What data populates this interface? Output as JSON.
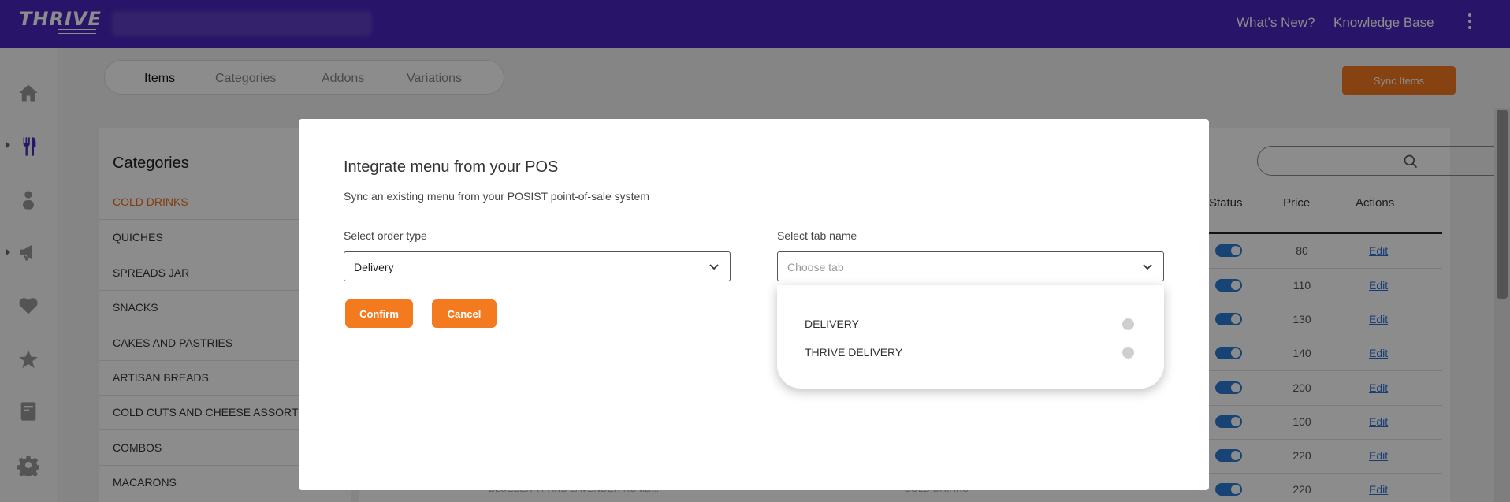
{
  "topbar": {
    "logo": "THRIVE",
    "links": [
      "What's New?",
      "Knowledge Base"
    ]
  },
  "tabs": [
    {
      "label": "Items",
      "active": true
    },
    {
      "label": "Categories",
      "active": false
    },
    {
      "label": "Addons",
      "active": false
    },
    {
      "label": "Variations",
      "active": false
    }
  ],
  "sync_button": "Sync Items",
  "categories": {
    "title": "Categories",
    "items": [
      "COLD DRINKS",
      "QUICHES",
      "SPREADS JAR",
      "SNACKS",
      "CAKES AND PASTRIES",
      "ARTISAN BREADS",
      "COLD CUTS AND CHEESE ASSORTM",
      "COMBOS",
      "MACARONS"
    ]
  },
  "table": {
    "headers": [
      "Status",
      "Price",
      "Actions"
    ],
    "rows": [
      {
        "price": "80",
        "action": "Edit"
      },
      {
        "price": "110",
        "action": "Edit"
      },
      {
        "price": "130",
        "action": "Edit"
      },
      {
        "price": "140",
        "action": "Edit"
      },
      {
        "price": "200",
        "action": "Edit"
      },
      {
        "price": "100",
        "action": "Edit"
      },
      {
        "price": "220",
        "action": "Edit"
      },
      {
        "price": "220",
        "action": "Edit"
      }
    ],
    "partial_row": {
      "name": "BLUEBERRY AND LAVENDER KOMB...",
      "category": "COLD DRINKS"
    }
  },
  "modal": {
    "title": "Integrate menu from your POS",
    "subtitle": "Sync an existing menu from your POSIST point-of-sale system",
    "order_type": {
      "label": "Select order type",
      "value": "Delivery"
    },
    "tab_name": {
      "label": "Select tab name",
      "placeholder": "Choose tab"
    },
    "confirm": "Confirm",
    "cancel": "Cancel",
    "options": [
      "DELIVERY",
      "THRIVE DELIVERY"
    ]
  },
  "colors": {
    "brand": "#4a26bd",
    "accent": "#f47a20",
    "link": "#2a6fd6"
  }
}
